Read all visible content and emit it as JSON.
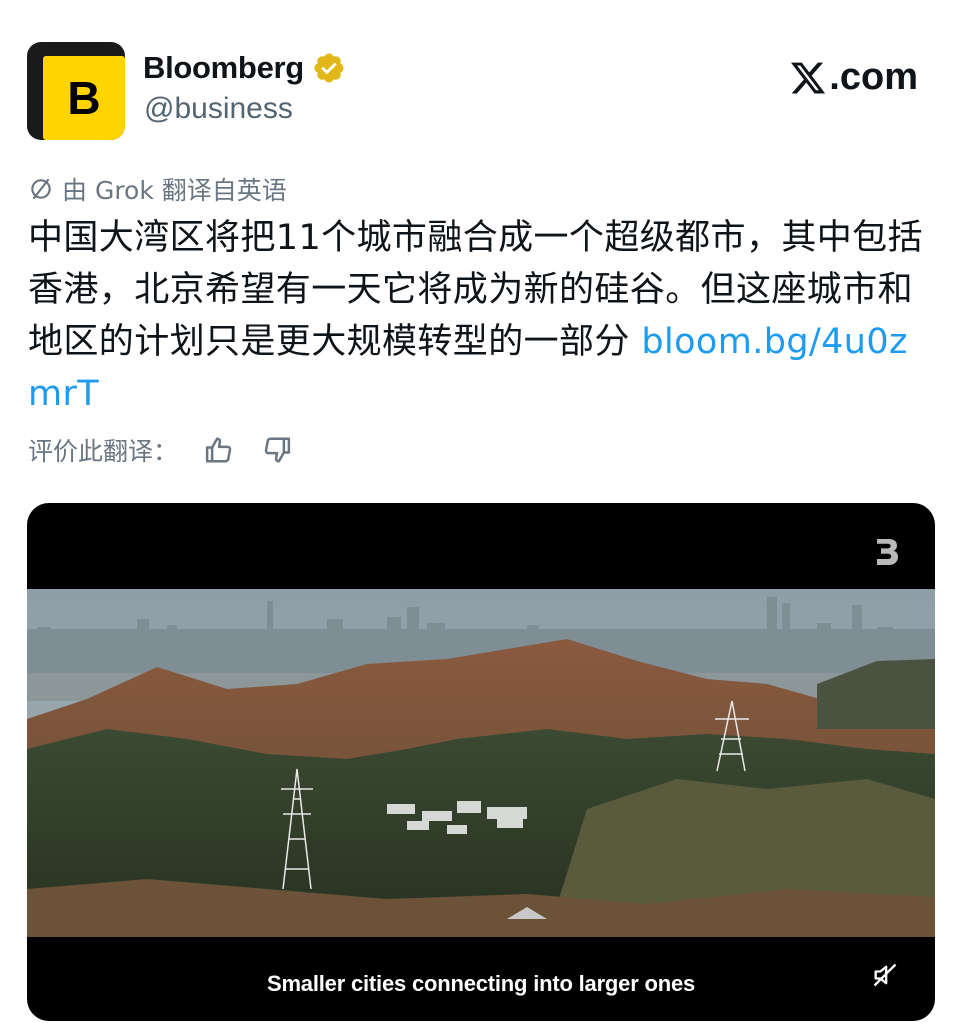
{
  "author": {
    "avatar_letter": "B",
    "display_name": "Bloomberg",
    "handle": "@business",
    "verified_badge": "gold-verified-icon"
  },
  "site": {
    "logo_icon": "x-logo-icon",
    "label": ".com"
  },
  "translation": {
    "icon": "translate-icon",
    "note": "由 Grok 翻译自英语"
  },
  "tweet": {
    "text": "中国大湾区将把11个城市融合成一个超级都市，其中包括香港，北京希望有一天它将成为新的硅谷。但这座城市和地区的计划只是更大规模转型的一部分 ",
    "link": "bloom.bg/4u0zmrT"
  },
  "rating": {
    "label": "评价此翻译：",
    "like_icon": "thumbs-up-icon",
    "dislike_icon": "thumbs-down-icon"
  },
  "video": {
    "caption": "Smaller cities connecting into larger ones",
    "channel_icon": "bloomberg-mark-icon",
    "mute_icon": "muted-speaker-icon"
  },
  "colors": {
    "link": "#1d9bf0",
    "secondary_text": "#536471",
    "brand_yellow": "#ffd400",
    "verified_gold": "#e2b719"
  }
}
